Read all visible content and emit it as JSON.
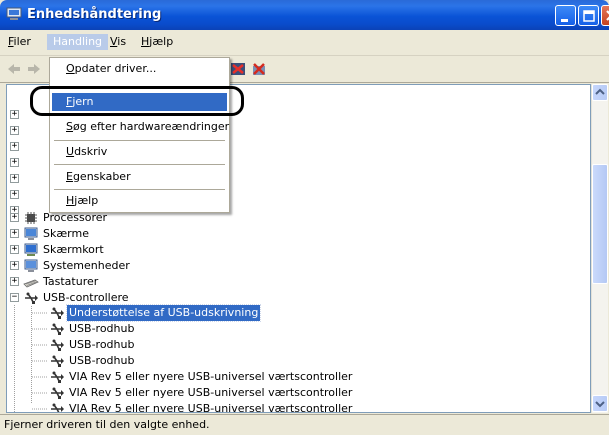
{
  "window": {
    "title": "Enhedshåndtering"
  },
  "menubar": {
    "items": [
      {
        "label": "Filer",
        "mnemonic": "F",
        "rest": "iler"
      },
      {
        "label": "Handling",
        "mnemonic": "",
        "rest": "Handling"
      },
      {
        "label": "Vis",
        "mnemonic": "V",
        "rest": "is"
      },
      {
        "label": "Hjælp",
        "mnemonic": "H",
        "rest": "jælp"
      }
    ]
  },
  "action_menu": {
    "items": [
      {
        "label": "Opdater driver...",
        "mnemonic": "O",
        "rest": "pdater driver..."
      },
      {
        "label": "Fjern",
        "mnemonic": "F",
        "rest": "jern"
      },
      {
        "label": "Søg efter hardwareændringer",
        "mnemonic": "S",
        "rest": "øg efter hardwareændringer"
      },
      {
        "label": "Udskriv",
        "mnemonic": "U",
        "rest": "dskriv"
      },
      {
        "label": "Egenskaber",
        "mnemonic": "E",
        "rest": "genskaber"
      },
      {
        "label": "Hjælp",
        "mnemonic": "H",
        "rest": "jælp"
      }
    ]
  },
  "tree": {
    "categories": [
      {
        "label": "Processorer",
        "icon": "processor-icon",
        "expanded": false
      },
      {
        "label": "Skærme",
        "icon": "monitor-icon",
        "expanded": false
      },
      {
        "label": "Skærmkort",
        "icon": "display-adapter-icon",
        "expanded": false
      },
      {
        "label": "Systemenheder",
        "icon": "system-device-icon",
        "expanded": false
      },
      {
        "label": "Tastaturer",
        "icon": "keyboard-icon",
        "expanded": false
      },
      {
        "label": "USB-controllere",
        "icon": "usb-icon",
        "expanded": true
      }
    ],
    "usb_children": [
      {
        "label": "Understøttelse af USB-udskrivning",
        "selected": true
      },
      {
        "label": "USB-rodhub",
        "selected": false
      },
      {
        "label": "USB-rodhub",
        "selected": false
      },
      {
        "label": "USB-rodhub",
        "selected": false
      },
      {
        "label": "VIA Rev 5 eller nyere USB-universel værtscontroller",
        "selected": false
      },
      {
        "label": "VIA Rev 5 eller nyere USB-universel værtscontroller",
        "selected": false
      },
      {
        "label": "VIA Rev 5 eller nyere USB-universel værtscontroller",
        "selected": false
      }
    ]
  },
  "statusbar": {
    "text": "Fjerner driveren til den valgte enhed."
  },
  "colors": {
    "selection": "#316ac5",
    "titlebar": "#0a53d6",
    "window_bg": "#ece9d8"
  }
}
